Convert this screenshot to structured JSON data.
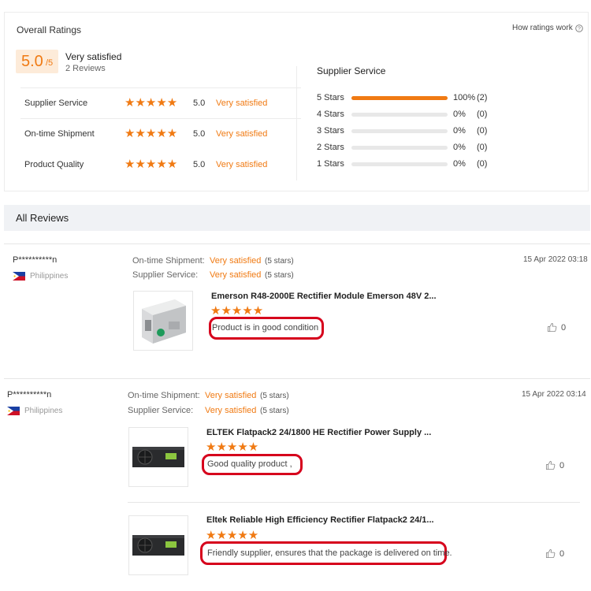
{
  "overall": {
    "title": "Overall Ratings",
    "how_link": "How ratings work",
    "score": "5.0",
    "score_suffix": "/5",
    "score_label": "Very satisfied",
    "reviews_count": "2 Reviews",
    "categories": [
      {
        "label": "Supplier Service",
        "value": "5.0",
        "text": "Very satisfied"
      },
      {
        "label": "On-time Shipment",
        "value": "5.0",
        "text": "Very satisfied"
      },
      {
        "label": "Product Quality",
        "value": "5.0",
        "text": "Very satisfied"
      }
    ]
  },
  "breakdown": {
    "title": "Supplier Service",
    "rows": [
      {
        "label": "5 Stars",
        "percent": "100%",
        "count": "(2)",
        "fill": 1.0
      },
      {
        "label": "4 Stars",
        "percent": "0%",
        "count": "(0)",
        "fill": 0
      },
      {
        "label": "3 Stars",
        "percent": "0%",
        "count": "(0)",
        "fill": 0
      },
      {
        "label": "2 Stars",
        "percent": "0%",
        "count": "(0)",
        "fill": 0
      },
      {
        "label": "1 Stars",
        "percent": "0%",
        "count": "(0)",
        "fill": 0
      }
    ]
  },
  "all_reviews_title": "All Reviews",
  "reviews": [
    {
      "user": "P**********n",
      "country": "Philippines",
      "date": "15 Apr 2022 03:18",
      "shipment_label": "On-time Shipment:",
      "shipment_value": "Very satisfied",
      "shipment_stars": "(5 stars)",
      "service_label": "Supplier Service:",
      "service_value": "Very satisfied",
      "service_stars": "(5 stars)",
      "items": [
        {
          "title": "Emerson R48-2000E Rectifier Module Emerson 48V 2...",
          "comment": "Product is in good condition",
          "likes": "0"
        }
      ]
    },
    {
      "user": "P**********n",
      "country": "Philippines",
      "date": "15 Apr 2022 03:14",
      "shipment_label": "On-time Shipment:",
      "shipment_value": "Very satisfied",
      "shipment_stars": "(5 stars)",
      "service_label": "Supplier Service:",
      "service_value": "Very satisfied",
      "service_stars": "(5 stars)",
      "items": [
        {
          "title": "ELTEK Flatpack2 24/1800 HE Rectifier Power Supply ...",
          "comment": "Good quality product ,",
          "likes": "0"
        },
        {
          "title": "Eltek Reliable High Efficiency Rectifier Flatpack2 24/1...",
          "comment": "Friendly supplier, ensures that the package is delivered on time.",
          "likes": "0"
        }
      ]
    }
  ],
  "colors": {
    "accent": "#f07a13",
    "highlight": "#d6001c"
  }
}
